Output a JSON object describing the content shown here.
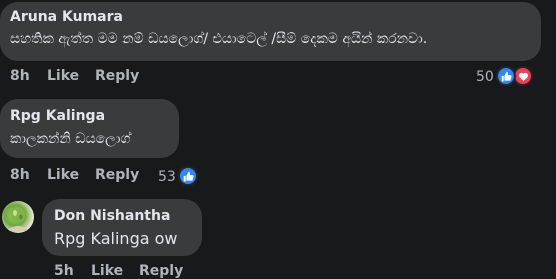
{
  "comments": [
    {
      "author": "Aruna Kumara",
      "text": "සහතික ඇත්ත මම නම් ඩයලොග්/ එයාටෙල් /සීම් දෙකම අයින් කරනවා.",
      "time": "8h",
      "like_label": "Like",
      "reply_label": "Reply",
      "reaction_count": "50",
      "reactions": [
        "like-icon",
        "love-icon"
      ]
    },
    {
      "author": "Rpg Kalinga",
      "text": "කාලකන්නි ඩයලොග්",
      "time": "8h",
      "like_label": "Like",
      "reply_label": "Reply",
      "reaction_count": "53",
      "reactions": [
        "like-icon"
      ]
    },
    {
      "author": "Don Nishantha",
      "mention": "Rpg Kalinga",
      "text": " ow",
      "time": "5h",
      "like_label": "Like",
      "reply_label": "Reply"
    }
  ],
  "colors": {
    "background": "#18191a",
    "bubble": "#3a3b3c",
    "like": "#2d88ff",
    "love": "#f33e58"
  }
}
